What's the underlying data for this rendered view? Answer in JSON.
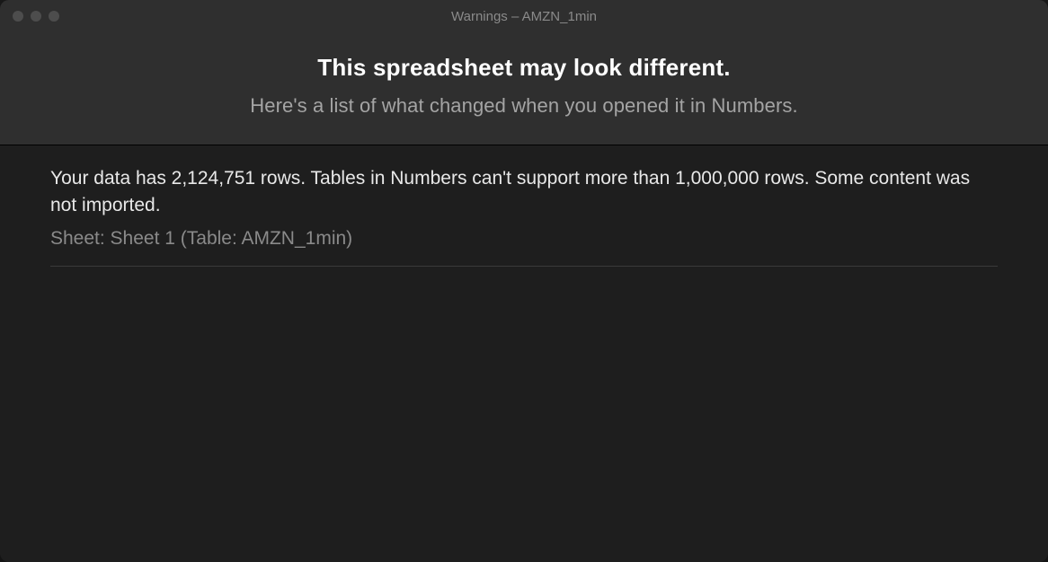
{
  "window": {
    "title": "Warnings – AMZN_1min"
  },
  "header": {
    "title": "This spreadsheet may look different.",
    "subtitle": "Here's a list of what changed when you opened it in Numbers."
  },
  "warnings": [
    {
      "message": "Your data has 2,124,751 rows. Tables in Numbers can't support more than 1,000,000 rows. Some content was not imported.",
      "location": "Sheet: Sheet 1 (Table: AMZN_1min)"
    }
  ]
}
